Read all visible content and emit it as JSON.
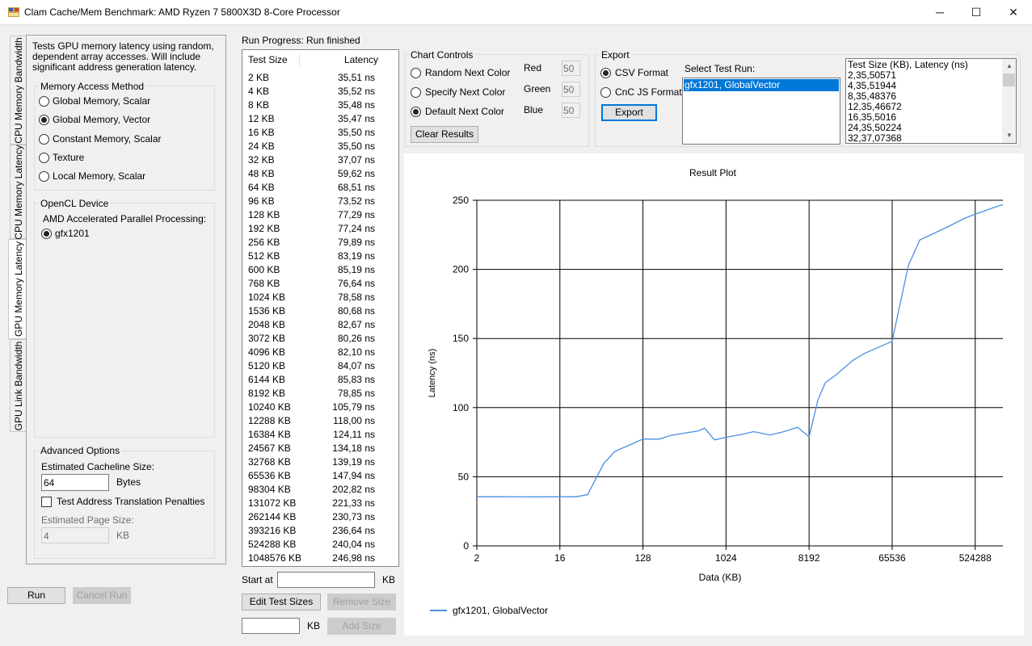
{
  "window": {
    "title": "Clam Cache/Mem Benchmark: AMD Ryzen 7 5800X3D 8-Core Processor",
    "minimize_glyph": "─",
    "maximize_glyph": "☐",
    "close_glyph": "✕"
  },
  "tabs": [
    {
      "label": "CPU Memory Bandwidth"
    },
    {
      "label": "CPU Memory Latency"
    },
    {
      "label": "GPU Memory Latency"
    },
    {
      "label": "GPU Link Bandwidth"
    }
  ],
  "left_panel": {
    "description": "Tests GPU memory latency using random, dependent array accesses. Will include significant address generation latency.",
    "memory_access_group": "Memory Access Method",
    "memory_access_options": [
      {
        "label": "Global Memory, Scalar",
        "checked": false
      },
      {
        "label": "Global Memory, Vector",
        "checked": true
      },
      {
        "label": "Constant Memory, Scalar",
        "checked": false
      },
      {
        "label": "Texture",
        "checked": false
      },
      {
        "label": "Local Memory, Scalar",
        "checked": false
      }
    ],
    "opencl_group": "OpenCL Device",
    "platform_label": "AMD Accelerated Parallel Processing:",
    "device_option": {
      "label": "gfx1201",
      "checked": true
    },
    "advanced_group": "Advanced Options",
    "cacheline_label": "Estimated Cacheline Size:",
    "cacheline_value": "64",
    "cacheline_unit": "Bytes",
    "tlb_checkbox_label": "Test Address Translation Penalties",
    "page_size_label": "Estimated Page Size:",
    "page_size_value": "4",
    "page_size_unit": "KB"
  },
  "buttons": {
    "run": "Run",
    "cancel_run": "Cancel Run",
    "edit_test_sizes": "Edit Test Sizes",
    "remove_size": "Remove Size",
    "add_size": "Add Size",
    "clear_results": "Clear Results",
    "export": "Export"
  },
  "run_progress": {
    "label": "Run Progress:",
    "status": "Run finished"
  },
  "results_table": {
    "col_size": "Test Size",
    "col_latency": "Latency",
    "rows": [
      [
        "2 KB",
        "35,51 ns"
      ],
      [
        "4 KB",
        "35,52 ns"
      ],
      [
        "8 KB",
        "35,48 ns"
      ],
      [
        "12 KB",
        "35,47 ns"
      ],
      [
        "16 KB",
        "35,50 ns"
      ],
      [
        "24 KB",
        "35,50 ns"
      ],
      [
        "32 KB",
        "37,07 ns"
      ],
      [
        "48 KB",
        "59,62 ns"
      ],
      [
        "64 KB",
        "68,51 ns"
      ],
      [
        "96 KB",
        "73,52 ns"
      ],
      [
        "128 KB",
        "77,29 ns"
      ],
      [
        "192 KB",
        "77,24 ns"
      ],
      [
        "256 KB",
        "79,89 ns"
      ],
      [
        "512 KB",
        "83,19 ns"
      ],
      [
        "600 KB",
        "85,19 ns"
      ],
      [
        "768 KB",
        "76,64 ns"
      ],
      [
        "1024 KB",
        "78,58 ns"
      ],
      [
        "1536 KB",
        "80,68 ns"
      ],
      [
        "2048 KB",
        "82,67 ns"
      ],
      [
        "3072 KB",
        "80,26 ns"
      ],
      [
        "4096 KB",
        "82,10 ns"
      ],
      [
        "5120 KB",
        "84,07 ns"
      ],
      [
        "6144 KB",
        "85,83 ns"
      ],
      [
        "8192 KB",
        "78,85 ns"
      ],
      [
        "10240 KB",
        "105,79 ns"
      ],
      [
        "12288 KB",
        "118,00 ns"
      ],
      [
        "16384 KB",
        "124,11 ns"
      ],
      [
        "24567 KB",
        "134,18 ns"
      ],
      [
        "32768 KB",
        "139,19 ns"
      ],
      [
        "65536 KB",
        "147,94 ns"
      ],
      [
        "98304 KB",
        "202,82 ns"
      ],
      [
        "131072 KB",
        "221,33 ns"
      ],
      [
        "262144 KB",
        "230,73 ns"
      ],
      [
        "393216 KB",
        "236,64 ns"
      ],
      [
        "524288 KB",
        "240,04 ns"
      ],
      [
        "1048576 KB",
        "246,98 ns"
      ]
    ]
  },
  "size_edit": {
    "start_at_label": "Start at",
    "start_at_value": "",
    "start_unit": "KB",
    "add_value": "",
    "add_unit": "KB"
  },
  "chart_controls": {
    "group": "Chart Controls",
    "options": [
      {
        "label": "Random Next Color",
        "checked": false
      },
      {
        "label": "Specify Next Color",
        "checked": false
      },
      {
        "label": "Default Next Color",
        "checked": true
      }
    ],
    "red_label": "Red",
    "red_value": "50",
    "green_label": "Green",
    "green_value": "50",
    "blue_label": "Blue",
    "blue_value": "50"
  },
  "export": {
    "group": "Export",
    "formats": [
      {
        "label": "CSV Format",
        "checked": true
      },
      {
        "label": "CnC JS Format",
        "checked": false
      }
    ],
    "select_label": "Select Test Run:",
    "runs": [
      "gfx1201, GlobalVector"
    ],
    "output_lines": [
      "Test Size (KB), Latency (ns)",
      "2,35,50571",
      "4,35,51944",
      "8,35,48376",
      "12,35,46672",
      "16,35,5016",
      "24,35,50224",
      "32,37,07368"
    ]
  },
  "chart_data": {
    "type": "line",
    "title": "Result Plot",
    "xlabel": "Data (KB)",
    "ylabel": "Latency (ns)",
    "x_scale": "log2",
    "xlim": [
      2,
      1048576
    ],
    "ylim": [
      0,
      250
    ],
    "x_ticks": [
      2,
      16,
      128,
      1024,
      8192,
      65536,
      524288
    ],
    "y_ticks": [
      0,
      50,
      100,
      150,
      200,
      250
    ],
    "grid": true,
    "legend": "bottom-left",
    "series": [
      {
        "name": "gfx1201, GlobalVector",
        "color": "#4a90e2",
        "x": [
          2,
          4,
          8,
          12,
          16,
          24,
          32,
          48,
          64,
          96,
          128,
          192,
          256,
          512,
          600,
          768,
          1024,
          1536,
          2048,
          3072,
          4096,
          5120,
          6144,
          8192,
          10240,
          12288,
          16384,
          24567,
          32768,
          65536,
          98304,
          131072,
          262144,
          393216,
          524288,
          1048576
        ],
        "y": [
          35.51,
          35.52,
          35.48,
          35.47,
          35.5,
          35.5,
          37.07,
          59.62,
          68.51,
          73.52,
          77.29,
          77.24,
          79.89,
          83.19,
          85.19,
          76.64,
          78.58,
          80.68,
          82.67,
          80.26,
          82.1,
          84.07,
          85.83,
          78.85,
          105.79,
          118.0,
          124.11,
          134.18,
          139.19,
          147.94,
          202.82,
          221.33,
          230.73,
          236.64,
          240.04,
          246.98
        ]
      }
    ]
  }
}
